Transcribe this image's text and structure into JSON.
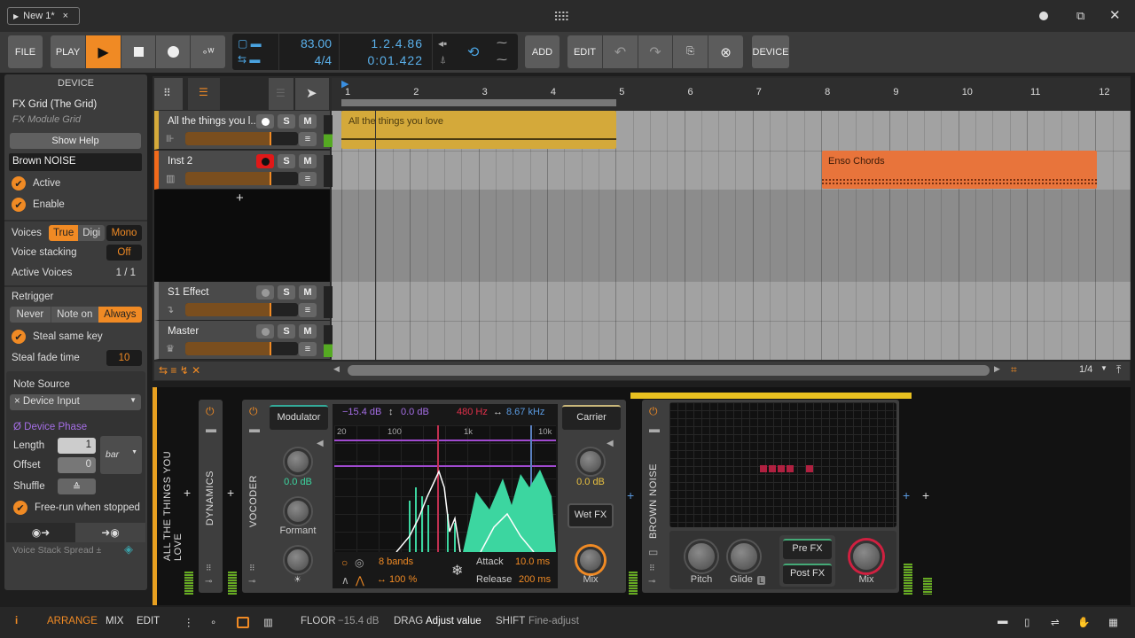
{
  "titlebar": {
    "tab": "New 1*",
    "close": "×"
  },
  "toolbar": {
    "file": "FILE",
    "play": "PLAY",
    "tempo": "83.00",
    "time_signature": "4/4",
    "position_beats": "1.2.4.86",
    "position_time": "0:01.422",
    "add": "ADD",
    "edit": "EDIT",
    "device": "DEVICE"
  },
  "device_panel": {
    "header": "DEVICE",
    "device_name": "FX Grid (The Grid)",
    "device_type": "FX Module Grid",
    "show_help": "Show Help",
    "preset_name": "Brown NOISE",
    "active": "Active",
    "enable": "Enable",
    "voices_label": "Voices",
    "voices_options": [
      "True",
      "Digi"
    ],
    "voices_selected": "True",
    "mono": "Mono",
    "voice_stacking_label": "Voice stacking",
    "voice_stacking_value": "Off",
    "active_voices_label": "Active Voices",
    "active_voices_value": "1 / 1",
    "retrigger_label": "Retrigger",
    "retrigger_options": [
      "Never",
      "Note on",
      "Always"
    ],
    "retrigger_selected": "Always",
    "steal_same_key": "Steal same key",
    "steal_fade_label": "Steal fade time",
    "steal_fade_value": "10",
    "note_source_label": "Note Source",
    "note_source_value": "× Device Input",
    "device_phase": "Ø Device Phase",
    "length_label": "Length",
    "length_value": "1",
    "offset_label": "Offset",
    "offset_value": "0",
    "unit": "bar",
    "shuffle_label": "Shuffle",
    "free_run": "Free-run when stopped",
    "voice_stack_spread": "Voice Stack Spread ±"
  },
  "arranger": {
    "ruler": [
      "1",
      "2",
      "3",
      "4",
      "5",
      "6",
      "7",
      "8",
      "9",
      "10",
      "11",
      "12"
    ],
    "tracks": [
      {
        "name": "All the things you l...",
        "color": "#d4a93a"
      },
      {
        "name": "Inst 2",
        "color": "#f26a1b"
      },
      {
        "name": "S1 Effect",
        "color": "#777777"
      },
      {
        "name": "Master",
        "color": "#777777"
      }
    ],
    "solo": "S",
    "mute": "M",
    "add": "+",
    "clips": [
      {
        "name": "All the things you love",
        "color": "#d4a93a"
      },
      {
        "name": "Enso Chords",
        "color": "#e8743b"
      }
    ],
    "zoom": "1/4"
  },
  "chain": {
    "track_name": "ALL THE THINGS YOU LOVE",
    "dynamics": "DYNAMICS",
    "vocoder": "VOCODER",
    "modulator_tab": "Modulator",
    "modulator_gain": "0.0 dB",
    "formant": "Formant",
    "floor": "−15.4 dB",
    "range": "0.0 dB",
    "low_freq": "480 Hz",
    "high_freq": "8.67 kHz",
    "freq_ticks": [
      "20",
      "100",
      "1k",
      "10k"
    ],
    "bands": "8 bands",
    "width": "↔ 100 %",
    "attack_label": "Attack",
    "attack": "10.0 ms",
    "release_label": "Release",
    "release": "200 ms",
    "carrier_tab": "Carrier",
    "carrier_gain": "0.0 dB",
    "wet_fx": "Wet FX",
    "mix": "Mix",
    "grid_device": "BROWN NOISE",
    "pitch": "Pitch",
    "glide": "Glide",
    "glide_badge": "L",
    "pre_fx": "Pre FX",
    "post_fx": "Post FX",
    "grid_mix": "Mix"
  },
  "statusbar": {
    "info": "i",
    "arrange": "ARRANGE",
    "mix": "MIX",
    "edit": "EDIT",
    "floor_label": "FLOOR",
    "floor_value": "−15.4 dB",
    "drag_label": "DRAG",
    "drag_value": "Adjust value",
    "shift_label": "SHIFT",
    "shift_value": "Fine-adjust"
  }
}
